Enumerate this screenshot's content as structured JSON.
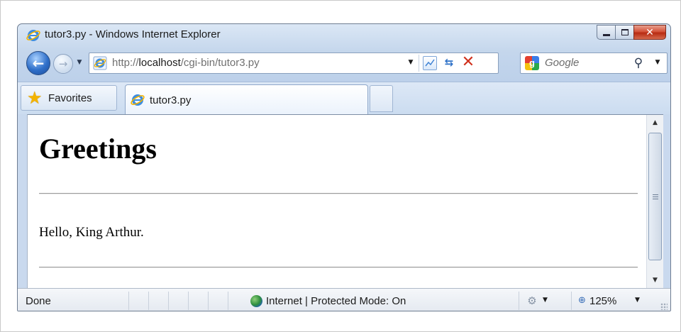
{
  "window": {
    "title": "tutor3.py - Windows Internet Explorer",
    "close_glyph": "✕"
  },
  "address_bar": {
    "url_prefix": "http://",
    "url_host": "localhost",
    "url_path": "/cgi-bin/tutor3.py"
  },
  "search": {
    "provider_letter": "g",
    "placeholder": "Google"
  },
  "favorites": {
    "label": "Favorites"
  },
  "tab": {
    "label": "tutor3.py"
  },
  "page": {
    "heading": "Greetings",
    "greeting": "Hello, King Arthur."
  },
  "status_bar": {
    "status": "Done",
    "zone": "Internet | Protected Mode: On",
    "zoom": "125%"
  },
  "icons": {
    "ie": "ie-logo-icon",
    "back": "back-arrow-icon",
    "forward": "forward-arrow-icon",
    "refresh": "refresh-icon",
    "stop": "stop-icon",
    "search": "magnifier-icon",
    "favorites": "star-icon",
    "globe": "globe-icon",
    "zoom": "magnifier-plus-icon"
  },
  "colors": {
    "frame_blue": "#c4d6ec",
    "close_red": "#c8381b",
    "stop_red": "#d0311d",
    "link_blue": "#2f72c8"
  }
}
